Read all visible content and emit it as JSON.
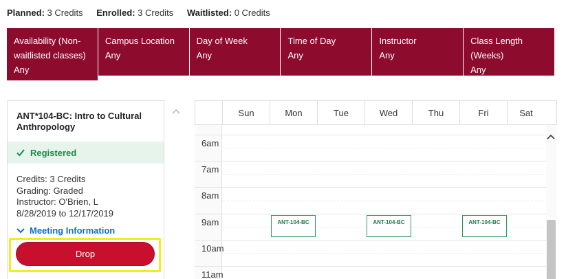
{
  "summary": {
    "planned_label": "Planned:",
    "planned_value": "3 Credits",
    "enrolled_label": "Enrolled:",
    "enrolled_value": "3 Credits",
    "waitlisted_label": "Waitlisted:",
    "waitlisted_value": "0 Credits"
  },
  "filters": [
    {
      "label": "Availability (Non-waitlisted classes)",
      "value": "Any"
    },
    {
      "label": "Campus Location",
      "value": "Any"
    },
    {
      "label": "Day of Week",
      "value": "Any"
    },
    {
      "label": "Time of Day",
      "value": "Any"
    },
    {
      "label": "Instructor",
      "value": "Any"
    },
    {
      "label": "Class Length (Weeks)",
      "value": "Any"
    }
  ],
  "course": {
    "title": "ANT*104-BC: Intro to Cultural Anthropology",
    "status": "Registered",
    "credits": "Credits: 3 Credits",
    "grading": "Grading: Graded",
    "instructor": "Instructor: O'Brien, L",
    "dates": "8/28/2019 to 12/17/2019",
    "meeting_info_label": "Meeting Information",
    "drop_label": "Drop"
  },
  "calendar": {
    "days": [
      "Sun",
      "Mon",
      "Tue",
      "Wed",
      "Thu",
      "Fri",
      "Sat"
    ],
    "hours": [
      "6am",
      "7am",
      "8am",
      "9am",
      "10am",
      "11am"
    ],
    "event_label": "ANT-104-BC",
    "event_days": [
      "Mon",
      "Wed",
      "Fri"
    ]
  },
  "colors": {
    "filter_bar": "#8d0c2e",
    "drop_button": "#c8102e",
    "registered": "#1d8a4a",
    "link": "#0d6ec9",
    "highlight": "#f1ee1c"
  }
}
